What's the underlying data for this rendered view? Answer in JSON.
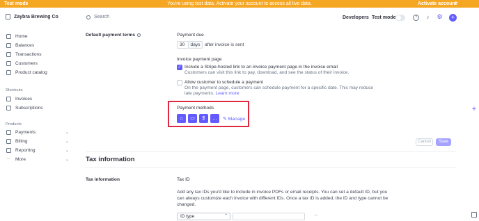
{
  "banner": {
    "mode_label": "Test mode",
    "message": "You're using test data. Activate your account to access all live data.",
    "activate_label": "Activate account",
    "activate_arrow": "↗",
    "color": "#f5a623"
  },
  "sidebar": {
    "brand": "Zaybra Brewing Co",
    "items": [
      {
        "label": "Home",
        "icon": "home-icon"
      },
      {
        "label": "Balances",
        "icon": "balances-icon"
      },
      {
        "label": "Transactions",
        "icon": "transactions-icon"
      },
      {
        "label": "Customers",
        "icon": "customers-icon"
      },
      {
        "label": "Product catalog",
        "icon": "product-catalog-icon"
      }
    ],
    "shortcuts_heading": "Shortcuts",
    "shortcuts": [
      {
        "label": "Invoices",
        "icon": "invoices-icon"
      },
      {
        "label": "Subscriptions",
        "icon": "subscriptions-icon"
      }
    ],
    "products_heading": "Products",
    "products": [
      {
        "label": "Payments",
        "icon": "payments-icon",
        "chevron": "⌄"
      },
      {
        "label": "Billing",
        "icon": "billing-icon",
        "chevron": "⌄"
      },
      {
        "label": "Reporting",
        "icon": "reporting-icon",
        "chevron": "⌄"
      },
      {
        "label": "More",
        "icon": "more-icon",
        "chevron": "⌄"
      }
    ]
  },
  "topbar": {
    "search_placeholder": "Search",
    "developers": "Developers",
    "test_mode": "Test mode",
    "test_mode_on": false,
    "help_glyph": "?",
    "bell_glyph": "♪",
    "gear_glyph": "⚙",
    "plus_glyph": "+"
  },
  "payment_terms": {
    "label": "Default payment terms",
    "due_label": "Payment due",
    "days_value": "30",
    "days_unit": "days",
    "after_text": "after invoice is sent"
  },
  "invoice_page": {
    "heading": "Invoice payment page",
    "include_link_title": "Include a Stripe-hosted link to an invoice payment page in the invoice email",
    "include_link_desc": "Customers can visit this link to pay, download, and see the status of their invoice.",
    "include_link_checked": true,
    "schedule_title": "Allow customer to schedule a payment",
    "schedule_desc": "On the payment page, customers can schedule payment for a specific date. This may reduce late payments.",
    "schedule_link": "Learn more",
    "schedule_checked": false
  },
  "payment_methods": {
    "heading": "Payment methods",
    "icons": [
      {
        "name": "bank-icon",
        "glyph": "⌂"
      },
      {
        "name": "card-icon",
        "glyph": "▭"
      },
      {
        "name": "dollar-icon",
        "glyph": "$"
      },
      {
        "name": "chat-icon",
        "glyph": "…"
      }
    ],
    "manage_label": "Manage",
    "manage_glyph": "✎",
    "highlight_color": "#e0283f"
  },
  "actions": {
    "cancel": "Cancel",
    "save": "Save"
  },
  "tax": {
    "section_title": "Tax information",
    "label": "Tax information",
    "tax_id_heading": "Tax ID",
    "tax_id_desc": "Add any tax IDs you'd like to include in invoice PDFs or email receipts. You can set a default ID, but you can always customize each invoice with different IDs. Once a tax ID is added, the ID and type cannot be changed.",
    "id_type_placeholder": "ID type",
    "id_type_arrows": "⌃",
    "id_hint": "--"
  },
  "colors": {
    "accent": "#635bff"
  }
}
